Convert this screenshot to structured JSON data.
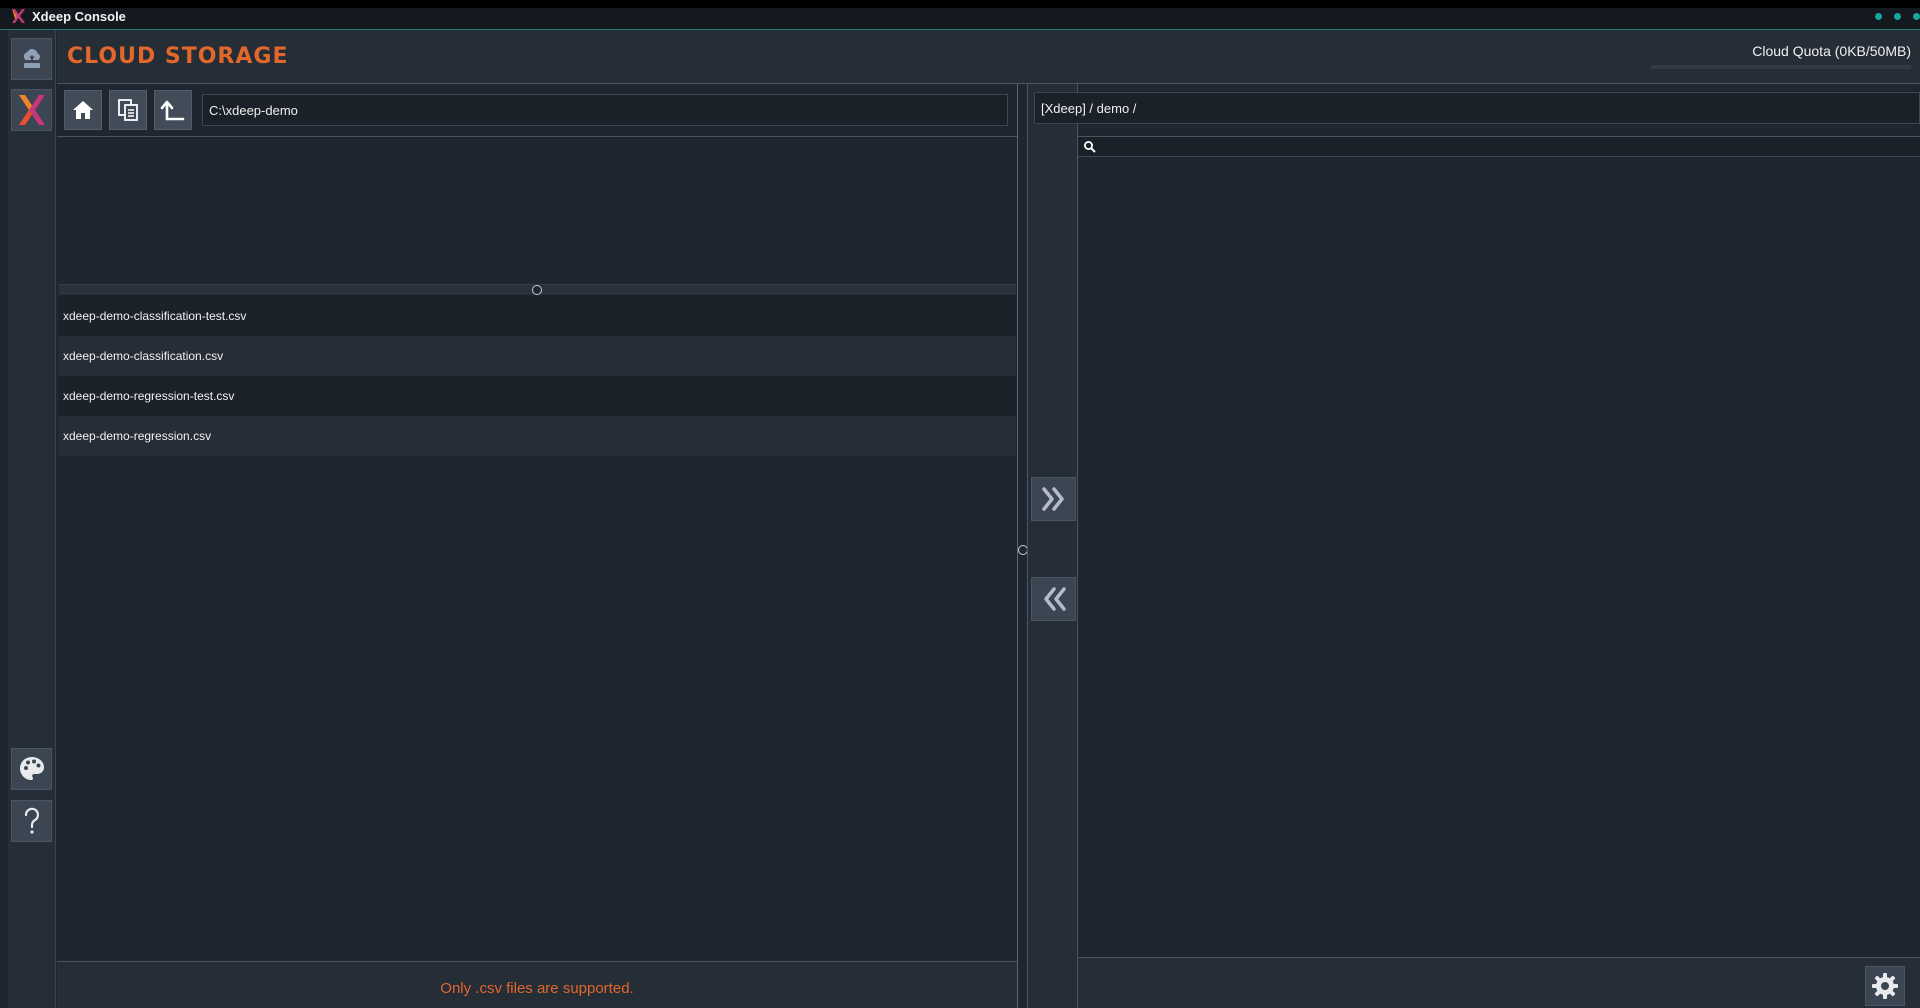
{
  "window": {
    "title": "Xdeep Console",
    "accent": "#16a6a0",
    "brand_orange": "#e2672c"
  },
  "rail": {
    "top_icons": [
      "cloud-upload-icon",
      "xdeep-logo-icon"
    ],
    "bottom_icons": [
      "palette-icon",
      "help-icon"
    ]
  },
  "header": {
    "title": "Cloud Storage",
    "quota_label": "Cloud Quota (0KB/50MB)",
    "quota_fraction": 0
  },
  "local": {
    "toolbar_icons": [
      "home-icon",
      "copy-icon",
      "up-folder-icon"
    ],
    "path": "C:\\xdeep-demo",
    "files": [
      "xdeep-demo-classification-test.csv",
      "xdeep-demo-classification.csv",
      "xdeep-demo-regression-test.csv",
      "xdeep-demo-regression.csv"
    ],
    "footer_note": "Only .csv files are supported."
  },
  "transfer": {
    "upload_label": "»",
    "download_label": "«"
  },
  "cloud": {
    "path": "[Xdeep] / demo /",
    "search_placeholder": "",
    "footer_icon": "gear-icon"
  }
}
